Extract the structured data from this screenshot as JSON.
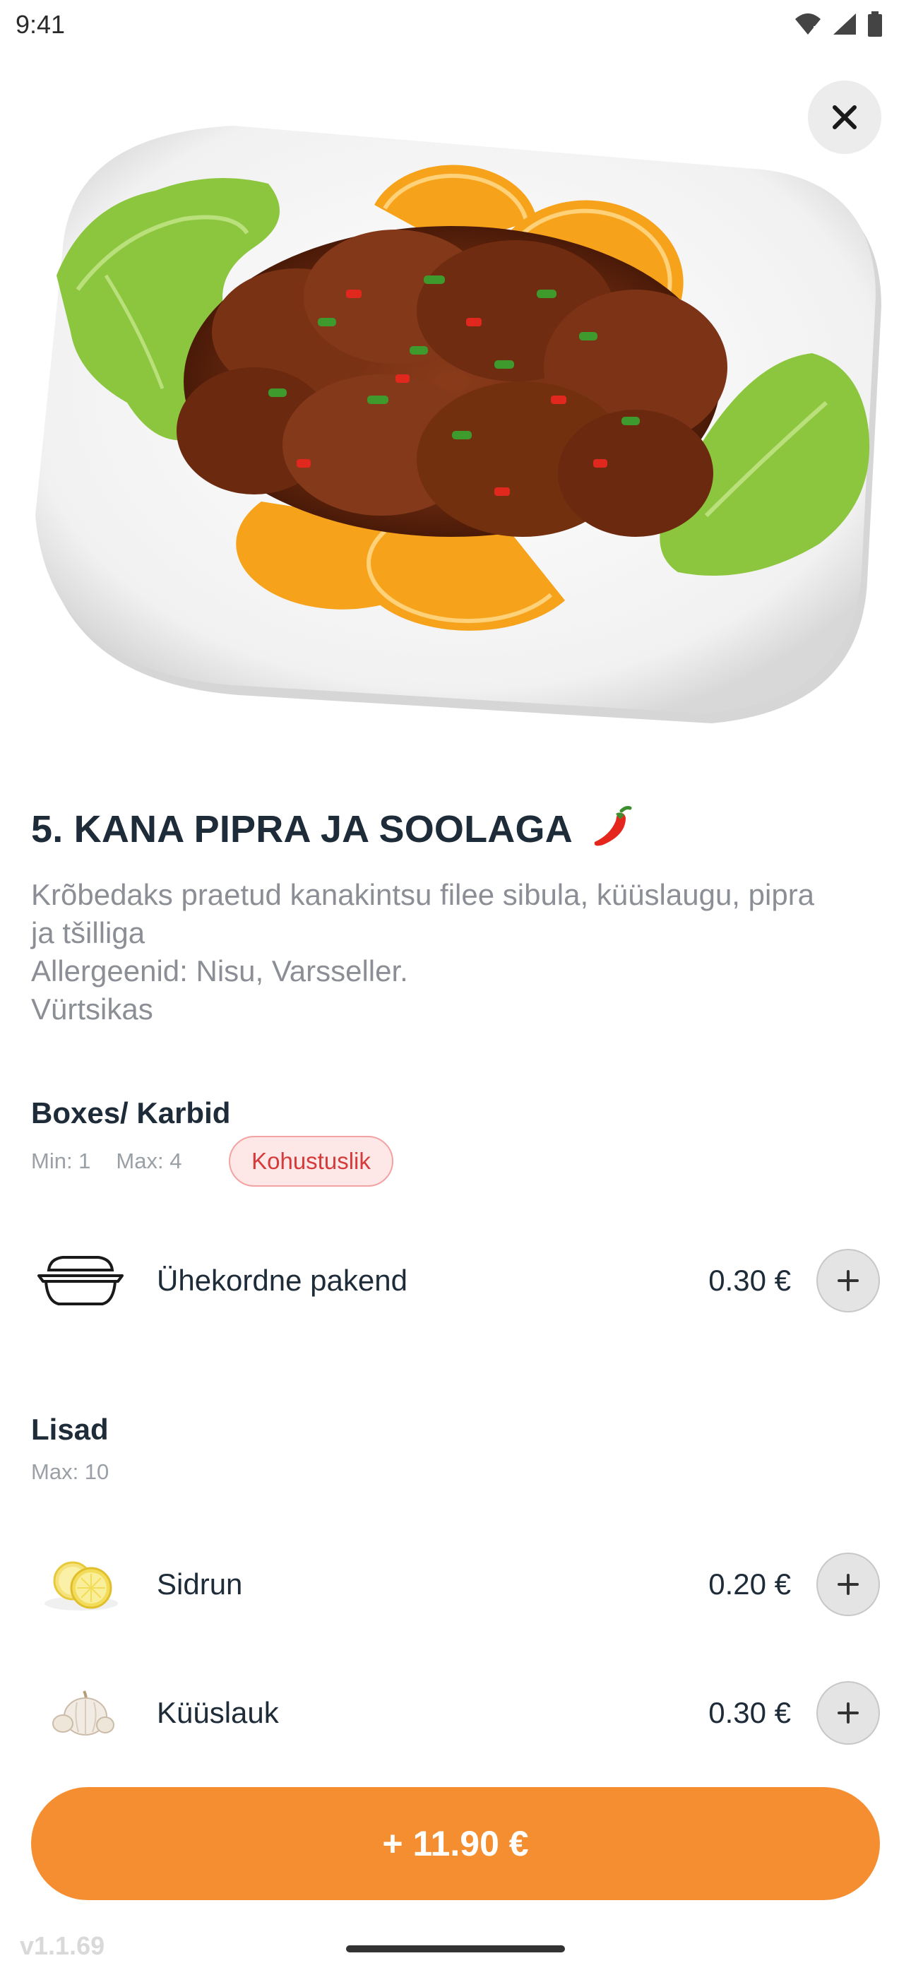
{
  "status_bar": {
    "time": "9:41",
    "icons": [
      "wifi-icon",
      "signal-icon",
      "battery-icon"
    ]
  },
  "dish": {
    "image": "fried-chicken-dish-image",
    "title": "5. KANA PIPRA JA SOOLAGA",
    "spicy_icon": "chili-pepper-icon",
    "description_lines": [
      "Krõbedaks praetud kanakintsu filee sibula, küüslaugu, pipra",
      "ja tšilliga",
      "Allergeenid: Nisu, Varsseller.",
      "Vürtsikas"
    ]
  },
  "boxes_section": {
    "title": "Boxes/ Karbid",
    "min_label": "Min: 1",
    "max_label": "Max: 4",
    "required_badge": "Kohustuslik",
    "options": [
      {
        "name": "Ühekordne pakend",
        "price": "0.30 €",
        "icon": "takeaway-box-icon"
      }
    ]
  },
  "extras_section": {
    "title": "Lisad",
    "max_label": "Max: 10",
    "options": [
      {
        "name": "Sidrun",
        "price": "0.20 €",
        "icon": "lemon-image"
      },
      {
        "name": "Küüslauk",
        "price": "0.30 €",
        "icon": "garlic-image"
      }
    ]
  },
  "cta": {
    "label": "+ 11.90 €"
  },
  "version": "v1.1.69",
  "colors": {
    "accent": "#f58e31",
    "badge_red": "#d63b3b",
    "text_dark": "#1e2b38",
    "text_muted": "#8b8f95"
  }
}
